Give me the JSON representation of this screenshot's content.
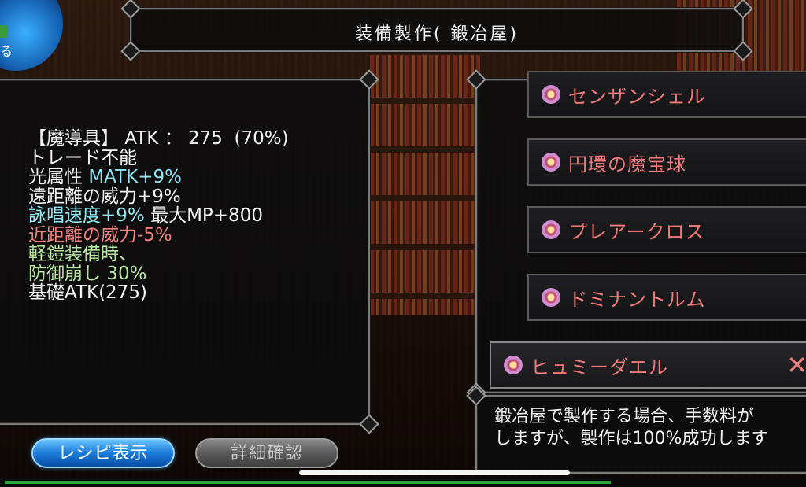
{
  "window": {
    "title": "装備製作( 鍛冶屋)"
  },
  "menu_orb": {
    "label": "る"
  },
  "item_stats": {
    "lines": [
      {
        "text": "【魔導具】 ATK ： 275  (70%)",
        "color": "white"
      },
      {
        "text": "トレード不能",
        "color": "white"
      },
      {
        "segments": [
          {
            "text": "光属性 ",
            "color": "white"
          },
          {
            "text": "MATK+9%",
            "color": "cyan"
          }
        ]
      },
      {
        "text": "遠距離の威力+9%",
        "color": "white"
      },
      {
        "segments": [
          {
            "text": "詠唱速度+9%",
            "color": "cyan"
          },
          {
            "text": " 最大MP+800",
            "color": "white"
          }
        ]
      },
      {
        "text": "近距離の威力-5%",
        "color": "red"
      },
      {
        "text": "軽鎧装備時、",
        "color": "green"
      },
      {
        "text": "防御崩し 30%",
        "color": "green"
      },
      {
        "text": "基礎ATK(275)",
        "color": "white"
      }
    ]
  },
  "recipes": {
    "items": [
      {
        "name": "センザンシェル",
        "icon": "material-orb-icon"
      },
      {
        "name": "円環の魔宝球",
        "icon": "material-orb-icon"
      },
      {
        "name": "プレアークロス",
        "icon": "material-orb-icon"
      },
      {
        "name": "ドミナントルム",
        "icon": "material-orb-icon"
      },
      {
        "name": "ヒュミーダエル",
        "icon": "material-orb-icon",
        "selected": true
      }
    ],
    "close_glyph": "✕"
  },
  "description": {
    "text": "鍛冶屋で製作する場合、手数料が\nしますが、製作は100%成功します"
  },
  "buttons": {
    "recipe_label": "レシピ表示",
    "detail_label": "詳細確認"
  },
  "colors": {
    "stat_white": "#f2f2f2",
    "stat_cyan": "#8fe6f2",
    "stat_red": "#f08080",
    "stat_green": "#b6e6a0",
    "recipe_name": "#f07a7a",
    "button_blue": "#1a7ad8",
    "button_gray": "#5a5a5a"
  }
}
